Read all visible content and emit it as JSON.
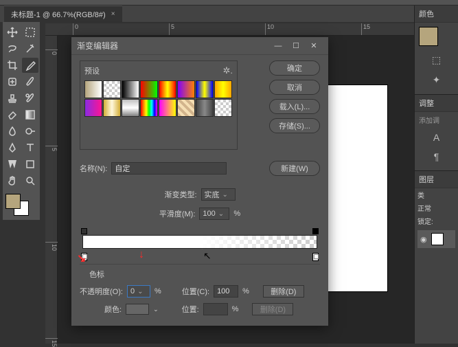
{
  "tab": {
    "title": "未标题-1 @ 66.7%(RGB/8#)"
  },
  "ruler_h": [
    "0",
    "5",
    "10",
    "15"
  ],
  "ruler_v": [
    "0",
    "5",
    "10",
    "15"
  ],
  "rpanel": {
    "color": "颜色",
    "adjust": "调整",
    "add_adj": "添加调",
    "layers": "图层",
    "kind": "类",
    "normal": "正常",
    "lock": "锁定:"
  },
  "dialog": {
    "title": "渐变编辑器",
    "presets": "预设",
    "ok": "确定",
    "cancel": "取消",
    "load": "载入(L)...",
    "save": "存储(S)...",
    "new": "新建(W)",
    "name_lbl": "名称(N):",
    "name_val": "自定",
    "type_lbl": "渐变类型:",
    "type_val": "实底",
    "smooth_lbl": "平滑度(M):",
    "smooth_val": "100",
    "pct": "%",
    "stops_hdr": "色标",
    "opacity_lbl": "不透明度(O):",
    "opacity_val": "0",
    "pos_lbl": "位置(C):",
    "pos_val": "100",
    "delete": "删除(D)",
    "color_lbl": "颜色:",
    "pos2_lbl": "位置:"
  },
  "gradients": [
    "linear-gradient(to right,#b5a57d,#fff)",
    "repeating-conic-gradient(#ccc 0 25%,#fff 0 50%)",
    "linear-gradient(to right,#000,#fff)",
    "linear-gradient(to right,#ff0000,#00ff00)",
    "linear-gradient(to right,#ff0000,#ffff00,#ff0000)",
    "linear-gradient(to right,#8000ff,#ff8000)",
    "linear-gradient(to right,#0000ff,#ffff00,#0000ff)",
    "linear-gradient(to right,#ffa500,#ffff00,#ffa500)",
    "linear-gradient(to right,#8a2be2,#ff1493)",
    "linear-gradient(to right,#d4af37,#fff8dc,#d4af37)",
    "linear-gradient(to bottom,#c0c0c0,#fff,#808080)",
    "linear-gradient(to right,#ff0000,#ff8000,#ffff00,#00ff00,#00ffff,#0000ff,#ff00ff)",
    "linear-gradient(to right,#ff00ff,#ffff00)",
    "repeating-linear-gradient(45deg,#d2b48c 0 4px,#f5deb3 4px 8px)",
    "linear-gradient(to right,#444,#888,#444)",
    "repeating-conic-gradient(#ccc 0 25%,#fff 0 50%)"
  ]
}
